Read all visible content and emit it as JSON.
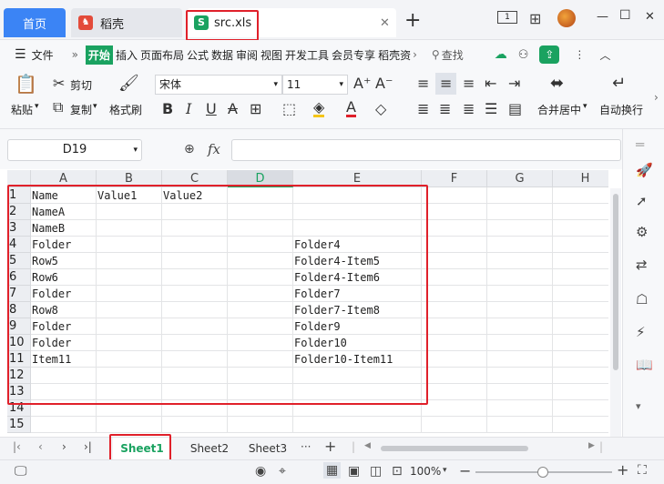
{
  "tabs": {
    "home": "首页",
    "daoke": "稻壳",
    "file": "src.xls",
    "add": "+"
  },
  "window": {
    "minimize": "—",
    "maximize": "☐",
    "close": "✕"
  },
  "menu": {
    "file": "文件",
    "items": [
      "开始",
      "插入",
      "页面布局",
      "公式",
      "数据",
      "审阅",
      "视图",
      "开发工具",
      "会员专享",
      "稻壳资"
    ],
    "search": "查找"
  },
  "ribbon": {
    "paste": "粘贴",
    "cut": "剪切",
    "copy": "复制",
    "format_painter": "格式刷",
    "font_name": "宋体",
    "font_size": "11",
    "merge": "合并居中",
    "wrap": "自动换行"
  },
  "formula": {
    "cell_ref": "D19",
    "fx": "fx",
    "value": ""
  },
  "grid": {
    "columns": [
      "A",
      "B",
      "C",
      "D",
      "E",
      "F",
      "G",
      "H"
    ],
    "selected_column": "D",
    "rows": [
      {
        "n": "1",
        "A": "Name",
        "B": "Value1",
        "C": "Value2",
        "E": ""
      },
      {
        "n": "2",
        "A": "NameA",
        "B": "",
        "C": "",
        "E": ""
      },
      {
        "n": "3",
        "A": "NameB",
        "B": "",
        "C": "",
        "E": ""
      },
      {
        "n": "4",
        "A": "Folder",
        "B": "",
        "C": "",
        "E": "Folder4"
      },
      {
        "n": "5",
        "A": "Row5",
        "B": "",
        "C": "",
        "E": "Folder4-Item5"
      },
      {
        "n": "6",
        "A": "Row6",
        "B": "",
        "C": "",
        "E": "Folder4-Item6"
      },
      {
        "n": "7",
        "A": "Folder",
        "B": "",
        "C": "",
        "E": "Folder7"
      },
      {
        "n": "8",
        "A": "Row8",
        "B": "",
        "C": "",
        "E": "Folder7-Item8"
      },
      {
        "n": "9",
        "A": "Folder",
        "B": "",
        "C": "",
        "E": "Folder9"
      },
      {
        "n": "10",
        "A": "Folder",
        "B": "",
        "C": "",
        "E": "Folder10"
      },
      {
        "n": "11",
        "A": "Item11",
        "B": "",
        "C": "",
        "E": "Folder10-Item11"
      },
      {
        "n": "12",
        "A": "",
        "B": "",
        "C": "",
        "E": ""
      },
      {
        "n": "13",
        "A": "",
        "B": "",
        "C": "",
        "E": ""
      },
      {
        "n": "14",
        "A": "",
        "B": "",
        "C": "",
        "E": ""
      },
      {
        "n": "15",
        "A": "",
        "B": "",
        "C": "",
        "E": ""
      }
    ]
  },
  "sheets": {
    "items": [
      "Sheet1",
      "Sheet2",
      "Sheet3"
    ],
    "active": "Sheet1",
    "more": "···",
    "add": "+"
  },
  "status": {
    "zoom": "100%",
    "zoom_level_percent": 100
  },
  "colors": {
    "highlight_red": "#e0202a",
    "active_sheet_green": "#1aa260",
    "home_tab_blue": "#3b84f5",
    "start_tab_green": "#1aa260"
  }
}
